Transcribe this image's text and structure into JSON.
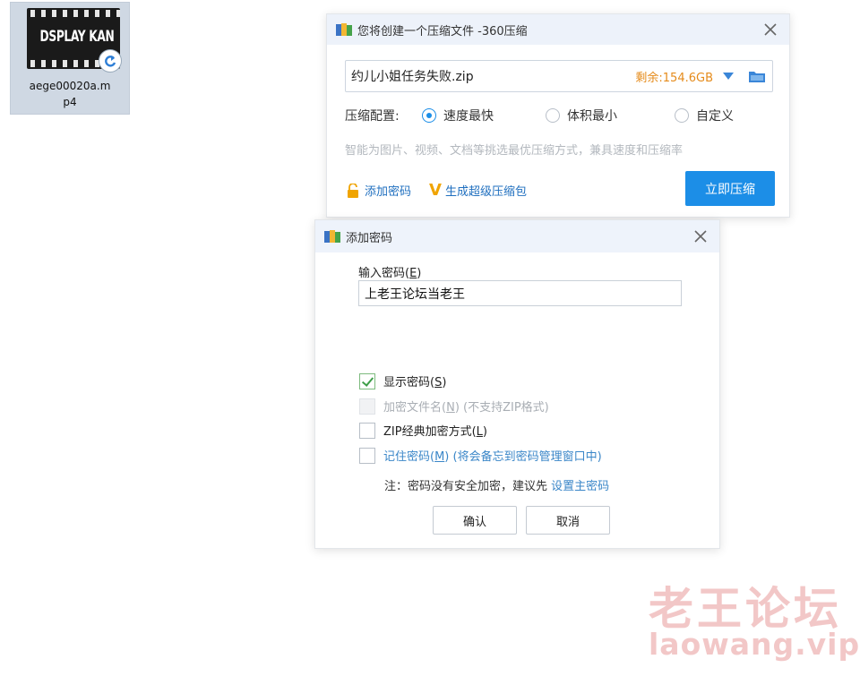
{
  "desktop_file": {
    "name_line1": "aege00020a.m",
    "name_line2": "p4",
    "thumbnail_text": "DSPLAY KAN",
    "icon": "video-file-icon",
    "badge_icon": "share-arrow-icon"
  },
  "compress_window": {
    "title": "您将创建一个压缩文件 -360压缩",
    "file_name": "约儿小姐任务失败.zip",
    "free_space": "剩余:154.6GB",
    "config_label": "压缩配置:",
    "options": [
      {
        "label": "速度最快",
        "selected": true
      },
      {
        "label": "体积最小",
        "selected": false
      },
      {
        "label": "自定义",
        "selected": false
      }
    ],
    "hint": "智能为图片、视频、文档等挑选最优压缩方式，兼具速度和压缩率",
    "add_password_link": "添加密码",
    "super_package_link": "生成超级压缩包",
    "compress_button": "立即压缩",
    "accent_color": "#1c8ee7"
  },
  "password_dialog": {
    "title": "添加密码",
    "input_label": "输入密码(",
    "input_label_key": "E",
    "input_label_end": ")",
    "password_value": "上老王论坛当老王",
    "checkboxes": [
      {
        "label": "显示密码(",
        "key": "S",
        "end": ")",
        "extra": "",
        "checked": true,
        "enabled": true
      },
      {
        "label": "加密文件名(",
        "key": "N",
        "end": ")",
        "extra": " (不支持ZIP格式)",
        "checked": false,
        "enabled": false
      },
      {
        "label": "ZIP经典加密方式(",
        "key": "L",
        "end": ")",
        "extra": "",
        "checked": false,
        "enabled": true
      },
      {
        "label": "记住密码(",
        "key": "M",
        "end": ")",
        "extra": " (将会备忘到密码管理窗口中)",
        "checked": false,
        "enabled": true
      }
    ],
    "note_prefix": "注：密码没有安全加密，建议先 ",
    "note_link": "设置主密码",
    "ok_button": "确认",
    "cancel_button": "取消"
  },
  "watermark": {
    "line1": "老王论坛",
    "line2": "laowang.vip"
  }
}
